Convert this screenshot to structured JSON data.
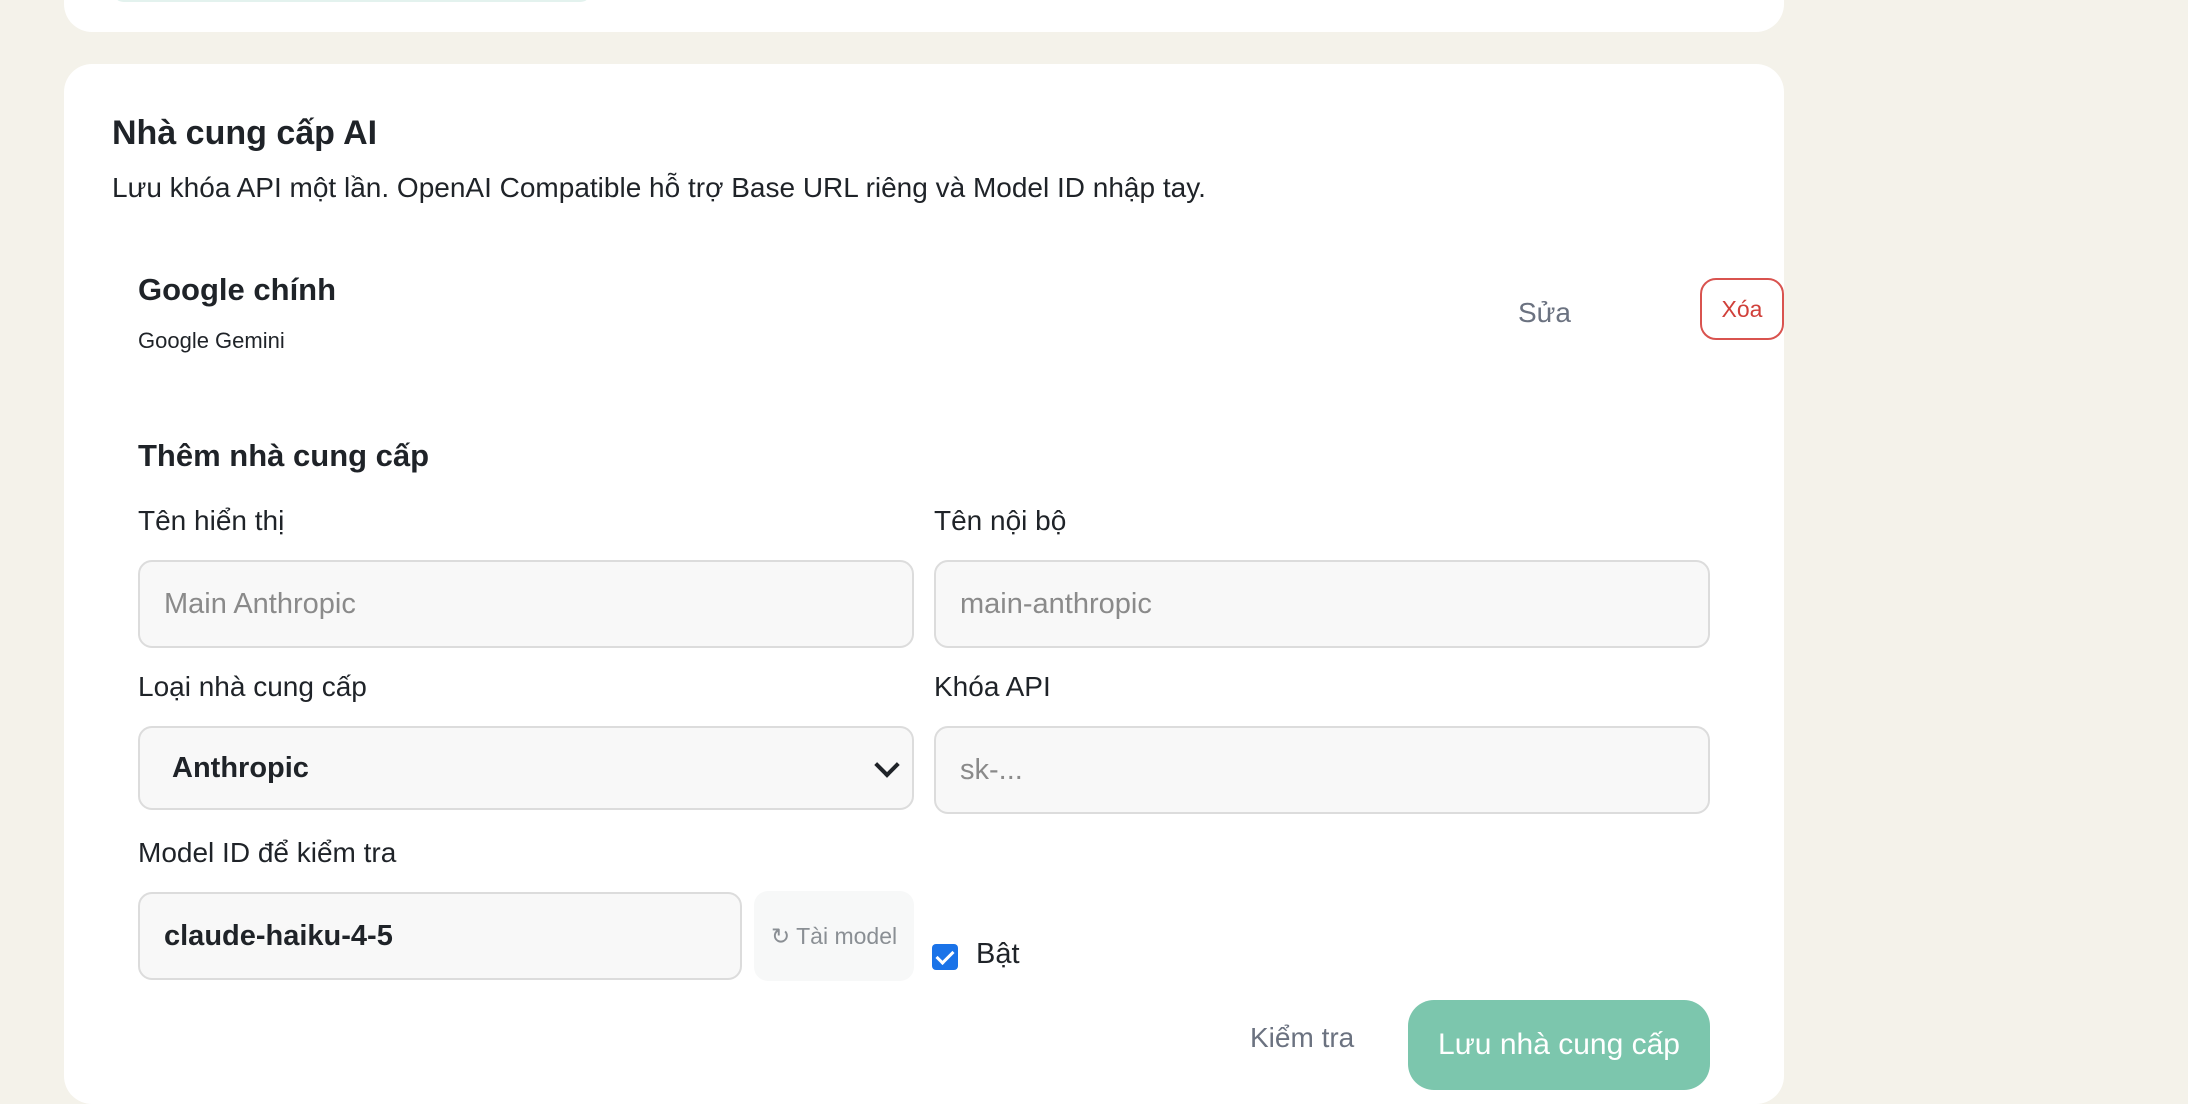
{
  "section": {
    "title": "Nhà cung cấp AI",
    "description": "Lưu khóa API một lần. OpenAI Compatible hỗ trợ Base URL riêng và Model ID nhập tay."
  },
  "providers": [
    {
      "name": "Google chính",
      "type": "Google Gemini",
      "edit_label": "Sửa",
      "delete_label": "Xóa"
    }
  ],
  "add_form": {
    "title": "Thêm nhà cung cấp",
    "display_name_label": "Tên hiển thị",
    "display_name_placeholder": "Main Anthropic",
    "internal_name_label": "Tên nội bộ",
    "internal_name_placeholder": "main-anthropic",
    "provider_type_label": "Loại nhà cung cấp",
    "provider_type_value": "Anthropic",
    "api_key_label": "Khóa API",
    "api_key_placeholder": "sk-...",
    "model_id_label": "Model ID để kiểm tra",
    "model_id_value": "claude-haiku-4-5",
    "fetch_models_label": "↻ Tài model",
    "enabled_label": "Bật",
    "enabled": true,
    "test_label": "Kiểm tra",
    "save_label": "Lưu nhà cung cấp"
  },
  "colors": {
    "page_bg": "#f4f2ea",
    "card_bg": "#ffffff",
    "danger": "#d0403a",
    "primary_disabled": "#7cc6ad",
    "checkbox": "#1a73e8"
  }
}
